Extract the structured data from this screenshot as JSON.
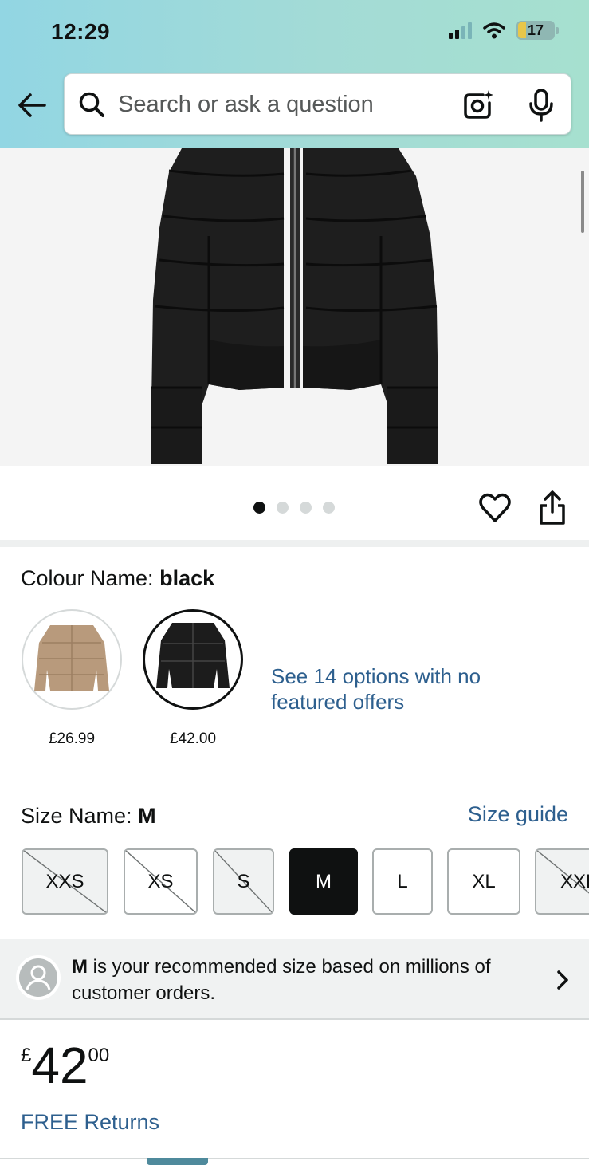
{
  "status_bar": {
    "time": "12:29",
    "battery": "17"
  },
  "header": {
    "search_placeholder": "Search or ask a question",
    "icons": [
      "back-arrow-icon",
      "search-icon",
      "camera-icon",
      "mic-icon"
    ]
  },
  "product": {
    "image_description_icon": "jacket-image",
    "carousel": {
      "total": 4,
      "active": 1
    },
    "actions": [
      "heart-icon",
      "share-icon"
    ]
  },
  "colour": {
    "label": "Colour Name: ",
    "selected": "black",
    "swatches": [
      {
        "price": "£26.99",
        "color": "#b89a7c"
      },
      {
        "price": "£42.00",
        "color": "#1c1c1c"
      }
    ],
    "see_options": "See 14 options with no featured offers"
  },
  "size": {
    "label": "Size Name: ",
    "selected": "M",
    "guide": "Size guide",
    "options": [
      {
        "label": "XXS",
        "state": "unavailable"
      },
      {
        "label": "XS",
        "state": "unavailable"
      },
      {
        "label": "S",
        "state": "unavailable"
      },
      {
        "label": "M",
        "state": "selected"
      },
      {
        "label": "L",
        "state": "available"
      },
      {
        "label": "XL",
        "state": "available"
      },
      {
        "label": "XXL",
        "state": "unavailable"
      }
    ]
  },
  "recommendation": {
    "size": "M",
    "text": " is your recommended size based on millions of customer orders."
  },
  "price": {
    "symbol": "£",
    "whole": "42",
    "fraction": "00"
  },
  "free_returns": "FREE Returns",
  "colors": {
    "link": "#2d5f8e",
    "selected_chip": "#0f1111"
  }
}
